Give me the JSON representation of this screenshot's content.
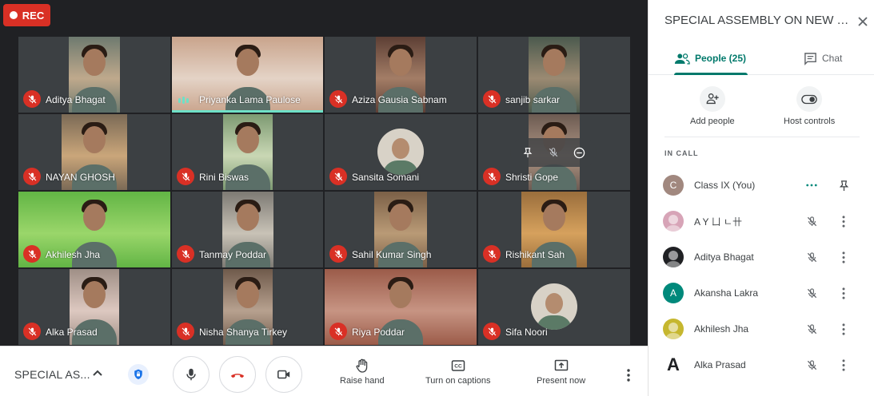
{
  "recording": {
    "label": "REC"
  },
  "tiles": [
    {
      "name": "Aditya Bhagat",
      "muted": true
    },
    {
      "name": "Priyanka Lama Paulose",
      "muted": false,
      "speaking": true
    },
    {
      "name": "Aziza Gausia Sabnam",
      "muted": true
    },
    {
      "name": "sanjib sarkar",
      "muted": true
    },
    {
      "name": "NAYAN GHOSH",
      "muted": true
    },
    {
      "name": "Rini Biswas",
      "muted": true
    },
    {
      "name": "Sansita Somani",
      "muted": true,
      "avatar": true
    },
    {
      "name": "Shristi Gope",
      "muted": true,
      "hover": true
    },
    {
      "name": "Akhilesh Jha",
      "muted": true
    },
    {
      "name": "Tanmay Poddar",
      "muted": true
    },
    {
      "name": "Sahil Kumar Singh",
      "muted": true
    },
    {
      "name": "Rishikant Sah",
      "muted": true
    },
    {
      "name": "Alka Prasad",
      "muted": true
    },
    {
      "name": "Nisha Shanya Tirkey",
      "muted": true
    },
    {
      "name": "Riya Poddar",
      "muted": true
    },
    {
      "name": "Sifa Noori",
      "muted": true,
      "avatar": true
    }
  ],
  "bottom_bar": {
    "meeting_title": "SPECIAL AS...",
    "raise_hand": "Raise hand",
    "captions": "Turn on captions",
    "present": "Present now"
  },
  "panel": {
    "title": "SPECIAL ASSEMBLY ON NEW YEA...",
    "tabs": {
      "people": "People (25)",
      "chat": "Chat"
    },
    "add_people": "Add people",
    "host_controls": "Host controls",
    "in_call_label": "IN CALL",
    "participants": [
      {
        "name": "Class IX (You)",
        "initial": "C",
        "color": "#a1887f",
        "you": true
      },
      {
        "name": "A Y ㄩ ㄴ卄",
        "initial": "",
        "color": "#d7a4b7"
      },
      {
        "name": "Aditya Bhagat",
        "initial": "",
        "color": "#202124"
      },
      {
        "name": "Akansha Lakra",
        "initial": "A",
        "color": "#00897b"
      },
      {
        "name": "Akhilesh Jha",
        "initial": "",
        "color": "#c6b72f"
      },
      {
        "name": "Alka Prasad",
        "initial": "A",
        "color": "#ffffff"
      }
    ]
  },
  "colors": {
    "accent": "#00796b",
    "mute_red": "#d93025",
    "speaking": "#6ee0c7"
  }
}
